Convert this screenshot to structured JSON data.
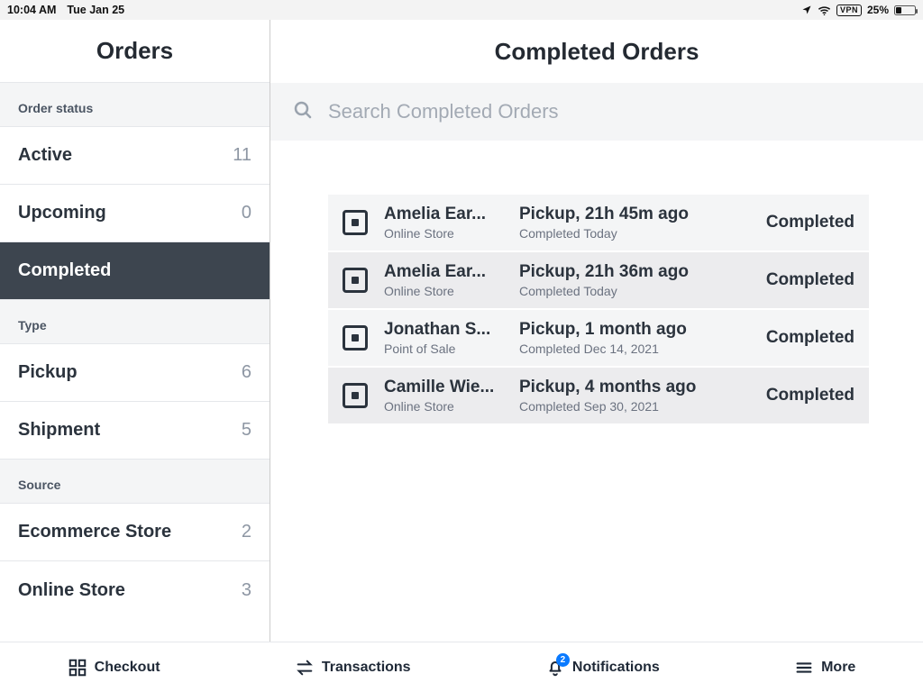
{
  "statusbar": {
    "time": "10:04 AM",
    "date": "Tue Jan 25",
    "vpn": "VPN",
    "battery_pct": "25%"
  },
  "sidebar": {
    "title": "Orders",
    "sections": {
      "status_header": "Order status",
      "type_header": "Type",
      "source_header": "Source"
    },
    "status": [
      {
        "label": "Active",
        "count": "11",
        "active": false
      },
      {
        "label": "Upcoming",
        "count": "0",
        "active": false
      },
      {
        "label": "Completed",
        "count": "",
        "active": true
      }
    ],
    "type": [
      {
        "label": "Pickup",
        "count": "6"
      },
      {
        "label": "Shipment",
        "count": "5"
      }
    ],
    "source": [
      {
        "label": "Ecommerce Store",
        "count": "2"
      },
      {
        "label": "Online Store",
        "count": "3"
      }
    ]
  },
  "main": {
    "title": "Completed Orders",
    "search_placeholder": "Search Completed Orders",
    "orders": [
      {
        "customer": "Amelia Ear...",
        "channel": "Online Store",
        "pickup": "Pickup, 21h 45m ago",
        "completed": "Completed Today",
        "status": "Completed"
      },
      {
        "customer": "Amelia Ear...",
        "channel": "Online Store",
        "pickup": "Pickup, 21h 36m ago",
        "completed": "Completed Today",
        "status": "Completed"
      },
      {
        "customer": "Jonathan S...",
        "channel": "Point of Sale",
        "pickup": "Pickup, 1 month ago",
        "completed": "Completed Dec 14, 2021",
        "status": "Completed"
      },
      {
        "customer": "Camille Wie...",
        "channel": "Online Store",
        "pickup": "Pickup, 4 months ago",
        "completed": "Completed Sep 30, 2021",
        "status": "Completed"
      }
    ]
  },
  "tabbar": {
    "checkout": "Checkout",
    "transactions": "Transactions",
    "notifications": "Notifications",
    "notifications_badge": "2",
    "more": "More"
  }
}
